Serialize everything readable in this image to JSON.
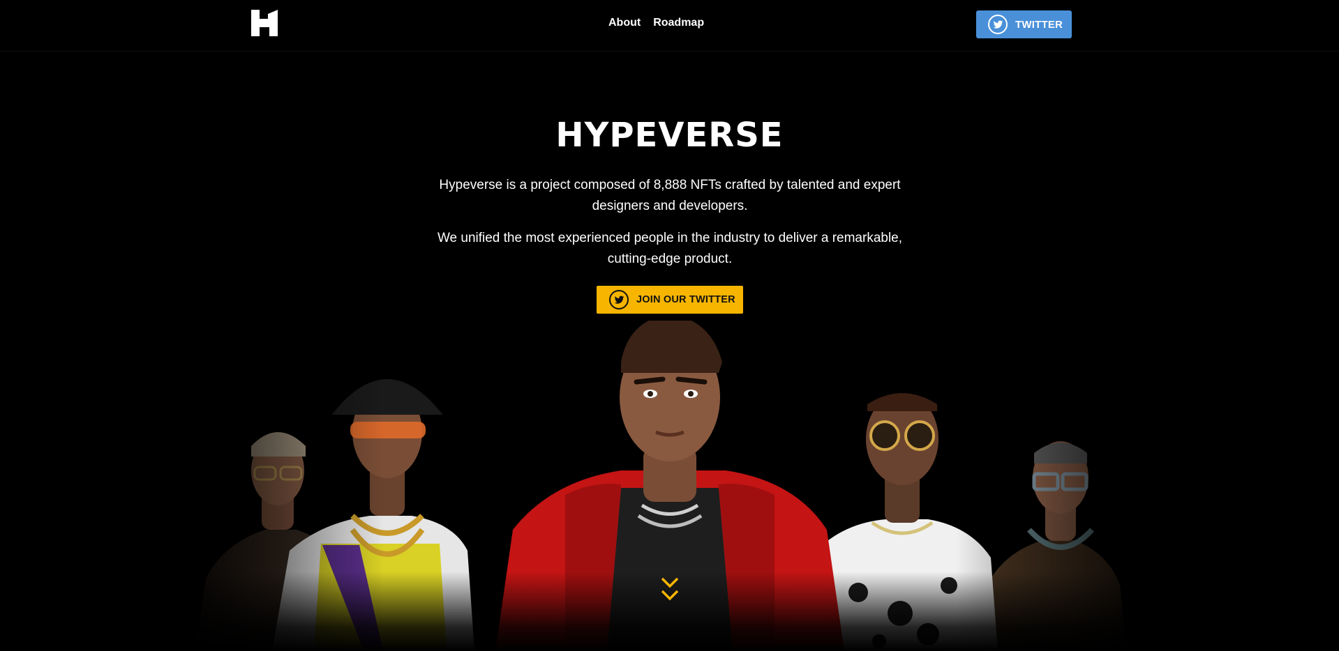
{
  "header": {
    "logo_letter": "H",
    "nav": [
      {
        "label": "About"
      },
      {
        "label": "Roadmap"
      }
    ],
    "twitter_button": {
      "label": "TWITTER",
      "icon": "twitter-bird-icon"
    }
  },
  "hero": {
    "title": "HYPEVERSE",
    "paragraph_1": "Hypeverse is a project composed of 8,888 NFTs crafted by talented and expert designers and developers.",
    "paragraph_2": "We unified the most experienced people in the industry to deliver a remarkable, cutting-edge product.",
    "cta_button": {
      "label": "JOIN OUR TWITTER",
      "icon": "twitter-bird-icon"
    }
  },
  "colors": {
    "background": "#000000",
    "twitter_blue": "#4a90d9",
    "accent_yellow": "#f7b500",
    "text": "#ffffff"
  },
  "scroll_indicator": {
    "icon": "double-chevron-down-icon"
  }
}
